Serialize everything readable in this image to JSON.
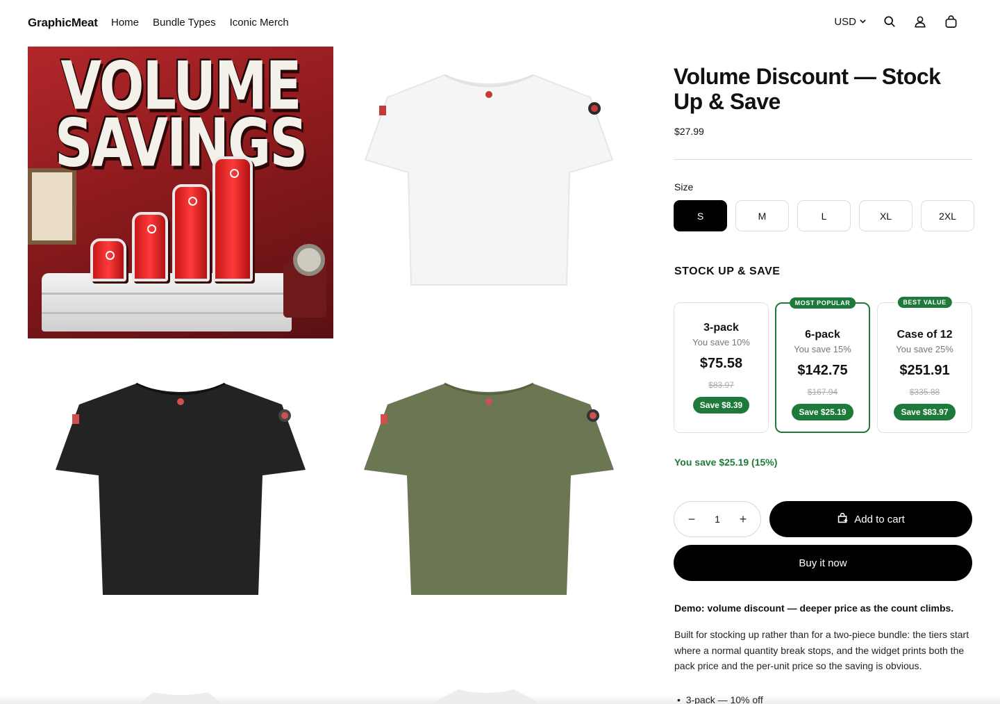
{
  "header": {
    "logo": "GraphicMeat",
    "nav": [
      "Home",
      "Bundle Types",
      "Iconic Merch"
    ],
    "currency": "USD",
    "icons": [
      "search-icon",
      "account-icon",
      "cart-icon"
    ]
  },
  "gallery": {
    "hero_text_line1": "VOLUME",
    "hero_text_line2": "SAVINGS",
    "images": [
      "white-tee",
      "black-tee",
      "olive-tee"
    ]
  },
  "product": {
    "title": "Volume Discount — Stock Up & Save",
    "price": "$27.99",
    "size_label": "Size",
    "sizes": [
      "S",
      "M",
      "L",
      "XL",
      "2XL"
    ],
    "selected_size": "S",
    "stock_heading": "STOCK UP & SAVE",
    "tiers": [
      {
        "name": "3-pack",
        "save": "You save 10%",
        "price": "$75.58",
        "old": "$83.97",
        "pill": "Save $8.39",
        "badge": ""
      },
      {
        "name": "6-pack",
        "save": "You save 15%",
        "price": "$142.75",
        "old": "$167.94",
        "pill": "Save $25.19",
        "badge": "MOST POPULAR"
      },
      {
        "name": "Case of 12",
        "save": "You save 25%",
        "price": "$251.91",
        "old": "$335.88",
        "pill": "Save $83.97",
        "badge": "BEST VALUE"
      }
    ],
    "you_save": "You save $25.19 (15%)",
    "qty": "1",
    "add_to_cart": "Add to cart",
    "buy_now": "Buy it now",
    "demo": "Demo: volume discount — deeper price as the count climbs.",
    "description": "Built for stocking up rather than for a two-piece bundle: the tiers start where a normal quantity break stops, and the widget prints both the pack price and the per-unit price so the saving is obvious.",
    "bullet": "3-pack — 10% off"
  },
  "colors": {
    "accent_green": "#1e7a3a",
    "black": "#000000",
    "olive": "#6b7752",
    "tee_black": "#232323"
  }
}
